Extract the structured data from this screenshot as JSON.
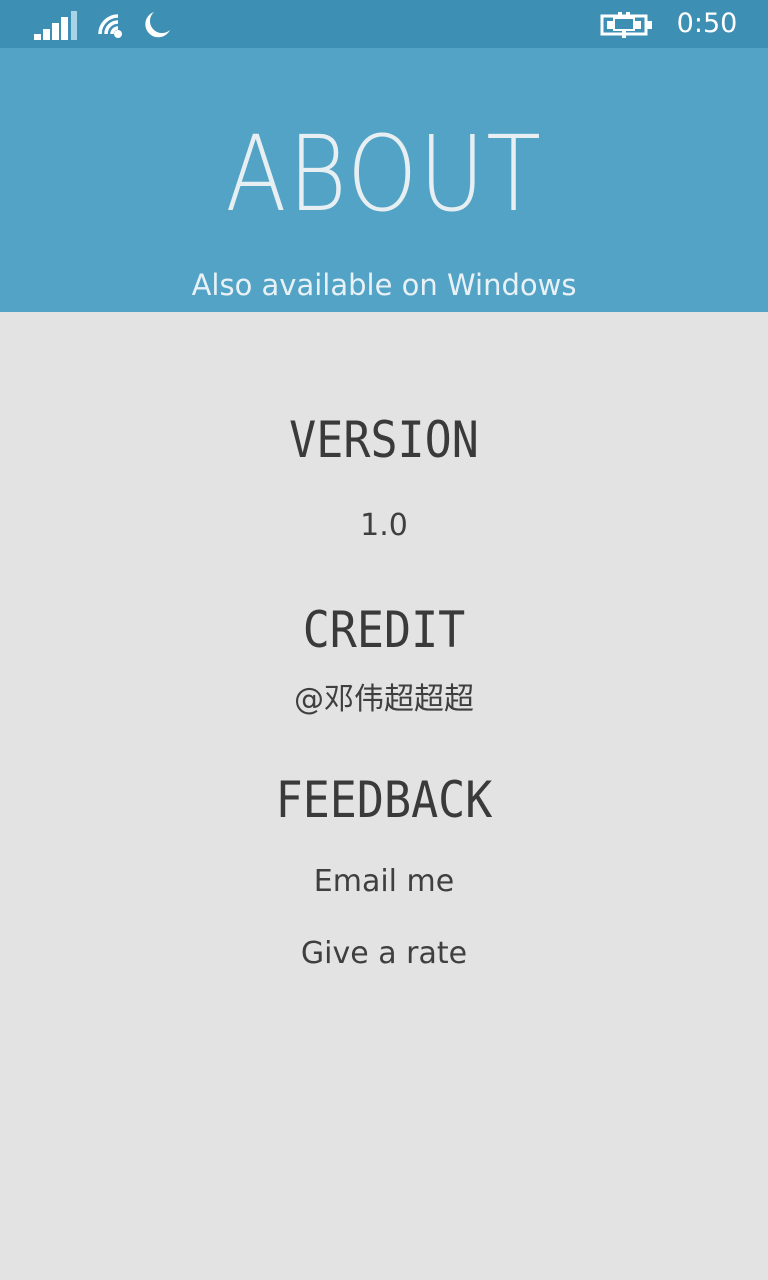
{
  "status_bar": {
    "time": "0:50",
    "icons": [
      "signal-icon",
      "wifi-icon",
      "moon-icon",
      "battery-charging-icon"
    ]
  },
  "header": {
    "title": "ABOUT",
    "subtitle": "Also available on Windows"
  },
  "sections": {
    "version": {
      "heading": "VERSION",
      "value": "1.0"
    },
    "credit": {
      "heading": "CREDIT",
      "value": "@邓伟超超超"
    },
    "feedback": {
      "heading": "FEEDBACK",
      "email_label": "Email me",
      "rate_label": "Give a rate"
    }
  },
  "colors": {
    "status_bar_bg": "#3d8fb4",
    "header_bg": "#52a3c6",
    "content_bg": "#e3e3e3",
    "text": "#3a3a3a"
  }
}
